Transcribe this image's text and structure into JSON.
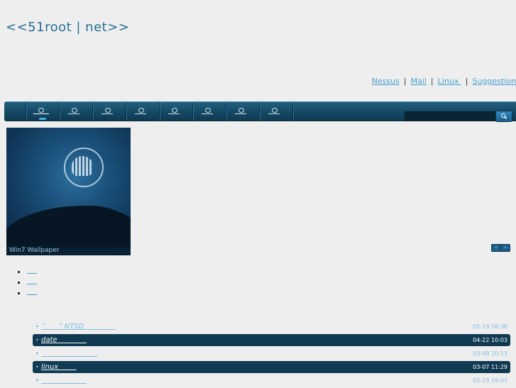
{
  "site": {
    "title": "<<51root | net>>"
  },
  "top_links": [
    {
      "label": "Nessus"
    },
    {
      "label": "Mail"
    },
    {
      "label": "Linux "
    },
    {
      "label": "Suggestion"
    }
  ],
  "nav": {
    "active_index": 0,
    "items_count_label": "",
    "search": {
      "placeholder": "",
      "value": ""
    }
  },
  "slideshow": {
    "caption": "Win7 Wallpaper"
  },
  "news": [
    {
      "title": "“      ” NTSD              ",
      "time": "05-19 16:36",
      "highlight": false
    },
    {
      "title": "date             ",
      "time": "04-22 10:03",
      "highlight": true
    },
    {
      "title": "                         ",
      "time": "03-09 20:13",
      "highlight": false
    },
    {
      "title": "linux        ",
      "time": "03-07 11:29",
      "highlight": true
    },
    {
      "title": "                    ",
      "time": "02-23 16:07",
      "highlight": false
    }
  ]
}
